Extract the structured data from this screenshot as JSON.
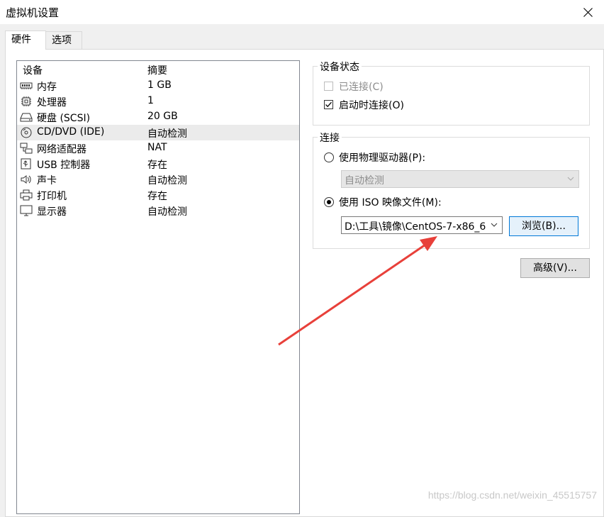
{
  "window": {
    "title": "虚拟机设置",
    "close_icon": "close-icon"
  },
  "tabs": [
    {
      "label": "硬件",
      "selected": true
    },
    {
      "label": "选项",
      "selected": false
    }
  ],
  "device_list": {
    "columns": [
      "设备",
      "摘要"
    ],
    "rows": [
      {
        "icon": "memory-icon",
        "name": "内存",
        "summary": "1 GB"
      },
      {
        "icon": "processor-icon",
        "name": "处理器",
        "summary": "1"
      },
      {
        "icon": "harddisk-icon",
        "name": "硬盘 (SCSI)",
        "summary": "20 GB"
      },
      {
        "icon": "cdrom-icon",
        "name": "CD/DVD (IDE)",
        "summary": "自动检测",
        "selected": true
      },
      {
        "icon": "network-icon",
        "name": "网络适配器",
        "summary": "NAT"
      },
      {
        "icon": "usb-icon",
        "name": "USB 控制器",
        "summary": "存在"
      },
      {
        "icon": "sound-icon",
        "name": "声卡",
        "summary": "自动检测"
      },
      {
        "icon": "printer-icon",
        "name": "打印机",
        "summary": "存在"
      },
      {
        "icon": "display-icon",
        "name": "显示器",
        "summary": "自动检测"
      }
    ]
  },
  "device_status": {
    "legend": "设备状态",
    "connected": {
      "label": "已连接(C)",
      "checked": false,
      "enabled": false
    },
    "connect_at_power_on": {
      "label": "启动时连接(O)",
      "checked": true,
      "enabled": true
    }
  },
  "connection": {
    "legend": "连接",
    "physical_drive": {
      "label": "使用物理驱动器(P):",
      "selected": false,
      "value": "自动检测"
    },
    "iso_image": {
      "label": "使用 ISO 映像文件(M):",
      "selected": true,
      "value": "D:\\工具\\镜像\\CentOS-7-x86_6"
    },
    "browse_label": "浏览(B)..."
  },
  "advanced_label": "高级(V)...",
  "watermark": "https://blog.csdn.net/weixin_45515757",
  "colors": {
    "annotation_arrow": "#e8403a",
    "selection_bg": "#ebebeb",
    "focus_border": "#0078d7"
  }
}
